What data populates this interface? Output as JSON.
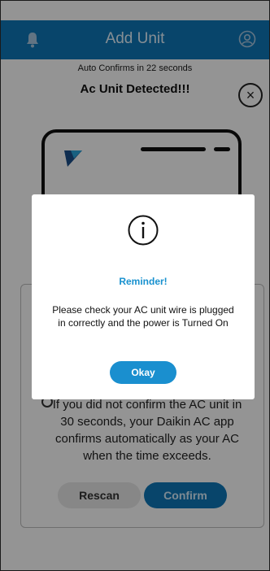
{
  "header": {
    "title": "Add Unit",
    "left_icon": "bell-icon",
    "right_icon": "user-circle-icon",
    "bg_color": "#0f78b8"
  },
  "main": {
    "auto_confirm_text": "Auto Confirms in 22 seconds",
    "detected_text": "Ac Unit Detected!!!",
    "close_icon": "close-circle-icon",
    "info_text": "If you did not confirm the AC unit in 30 seconds, your Daikin AC app confirms automatically as your AC when the time exceeds.",
    "rescan_label": "Rescan",
    "confirm_label": "Confirm"
  },
  "dialog": {
    "icon": "info-icon",
    "heading": "Reminder!",
    "message": "Please check your AC unit wire is plugged in correctly and the power is Turned On",
    "okay_label": "Okay",
    "accent_color": "#1891cf"
  }
}
